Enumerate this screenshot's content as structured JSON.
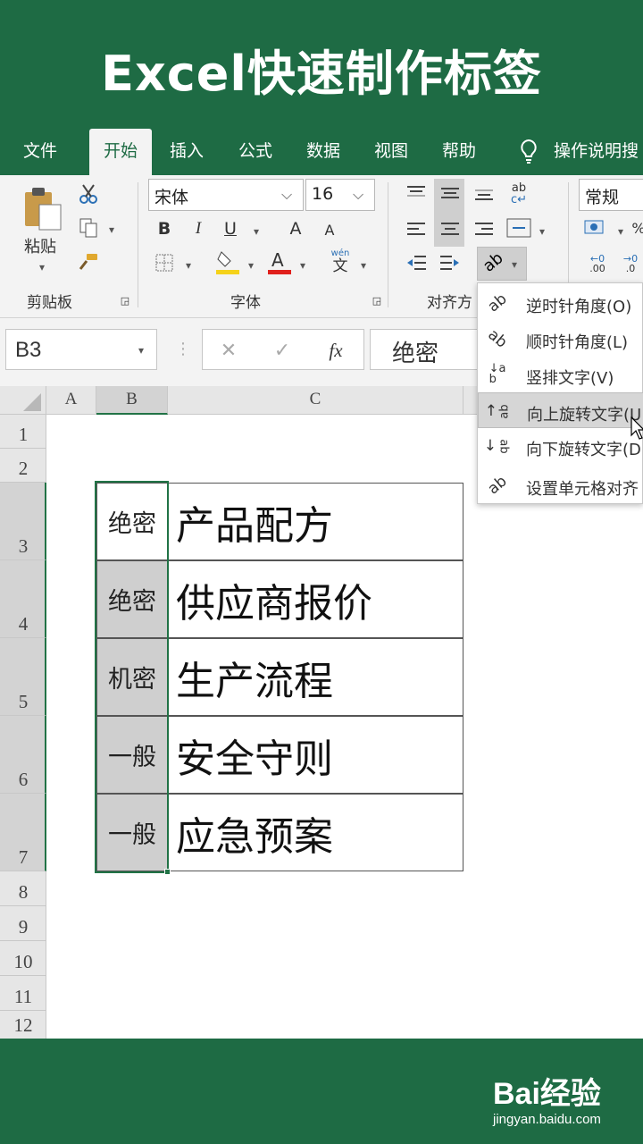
{
  "banner": {
    "title": "Excel快速制作标签"
  },
  "tabs": [
    {
      "label": "文件"
    },
    {
      "label": "开始"
    },
    {
      "label": "插入"
    },
    {
      "label": "公式"
    },
    {
      "label": "数据"
    },
    {
      "label": "视图"
    },
    {
      "label": "帮助"
    },
    {
      "label": "操作说明搜"
    }
  ],
  "ribbon": {
    "paste_label": "粘贴",
    "clipboard_group": "剪贴板",
    "font_name": "宋体",
    "font_size": "16",
    "bold": "B",
    "italic": "I",
    "underline": "U",
    "grow_font": "A",
    "shrink_font": "A",
    "font_color_glyph": "A",
    "phonetic_glyph": "文",
    "phonetic_top": "wén",
    "font_group": "字体",
    "align_group": "对齐方",
    "wrap_glyph": "ab",
    "number_format": "常规",
    "accent_red": "#e0201c",
    "accent_yellow": "#f5d21a"
  },
  "formula_bar": {
    "name_box": "B3",
    "cancel_glyph": "✕",
    "enter_glyph": "✓",
    "fx_glyph": "fx",
    "value": "绝密"
  },
  "sheet": {
    "columns": [
      "A",
      "B",
      "C"
    ],
    "rows": [
      {
        "num": "1"
      },
      {
        "num": "2"
      },
      {
        "num": "3",
        "b": "绝密",
        "c": "产品配方"
      },
      {
        "num": "4",
        "b": "绝密",
        "c": "供应商报价"
      },
      {
        "num": "5",
        "b": "机密",
        "c": "生产流程"
      },
      {
        "num": "6",
        "b": "一般",
        "c": "安全守则"
      },
      {
        "num": "7",
        "b": "一般",
        "c": "应急预案"
      },
      {
        "num": "8"
      },
      {
        "num": "9"
      },
      {
        "num": "10"
      },
      {
        "num": "11"
      },
      {
        "num": "12"
      }
    ]
  },
  "orientation_menu": {
    "items": [
      {
        "label": "逆时针角度(O)"
      },
      {
        "label": "顺时针角度(L)"
      },
      {
        "label": "竖排文字(V)"
      },
      {
        "label": "向上旋转文字(U"
      },
      {
        "label": "向下旋转文字(D"
      },
      {
        "label": "设置单元格对齐"
      }
    ]
  },
  "watermark": {
    "brand": "Bai经验",
    "url": "jingyan.baidu.com"
  },
  "colors": {
    "excel_green": "#1e6b44",
    "selection_green": "#217346"
  }
}
